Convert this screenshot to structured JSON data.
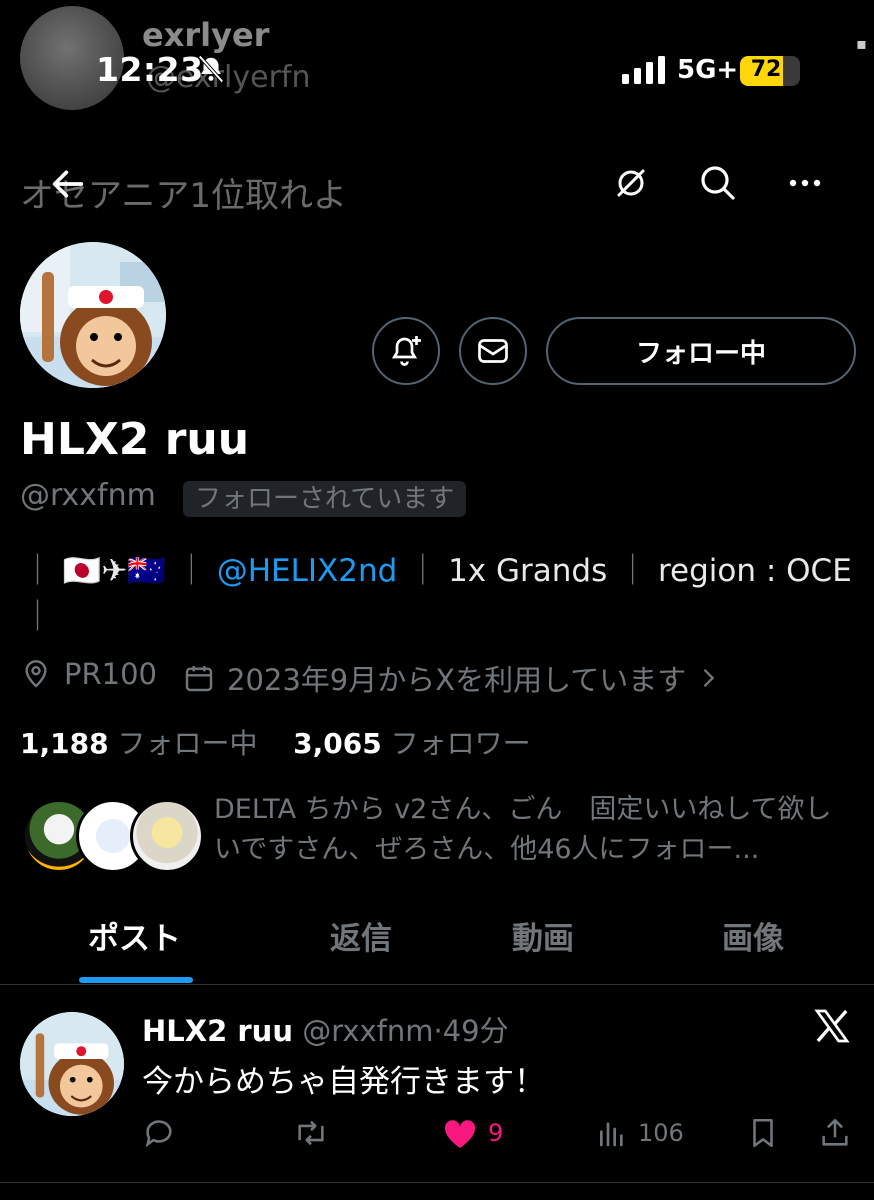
{
  "status_bar": {
    "time": "12:23",
    "network": "5G+",
    "battery_level": "72",
    "battery_fraction": 0.72
  },
  "overlay": {
    "ghost_name": "exrlyer",
    "ghost_handle": "@exrlyerfn",
    "ghost_bio": "オセアニア1位取れよ"
  },
  "toolbar": {
    "back_icon": "arrow-left-icon",
    "grok_icon": "grok-icon",
    "search_icon": "search-icon",
    "more_icon": "more-icon"
  },
  "profile": {
    "display_name": "HLX2 ruu",
    "handle": "@rxxfnm",
    "follows_you": "フォローされています",
    "follow_button": "フォロー中",
    "bio": {
      "sep": "｜",
      "emoji": "🇯🇵✈🇦🇺",
      "mention": "@HELIX2nd",
      "grands": "1x Grands",
      "region": "region : OCE"
    },
    "location": "PR100",
    "joined": "2023年9月からXを利用しています",
    "following_count": "1,188",
    "following_label": "フォロー中",
    "followers_count": "3,065",
    "followers_label": "フォロワー",
    "followed_by": "DELTA ちから v2さん、ごん　固定いいねして欲しいですさん、ぜろさん、他46人にフォロー..."
  },
  "tabs": [
    "ポスト",
    "返信",
    "動画",
    "画像"
  ],
  "post": {
    "name": "HLX2 ruu",
    "handle": "@rxxfnm",
    "time": "49分",
    "text": "今からめちゃ自発行きます！",
    "likes": "9",
    "views": "106"
  },
  "colors": {
    "accent": "#1d9bf0",
    "like": "#f91880",
    "muted": "#71767b",
    "background": "#000000"
  }
}
